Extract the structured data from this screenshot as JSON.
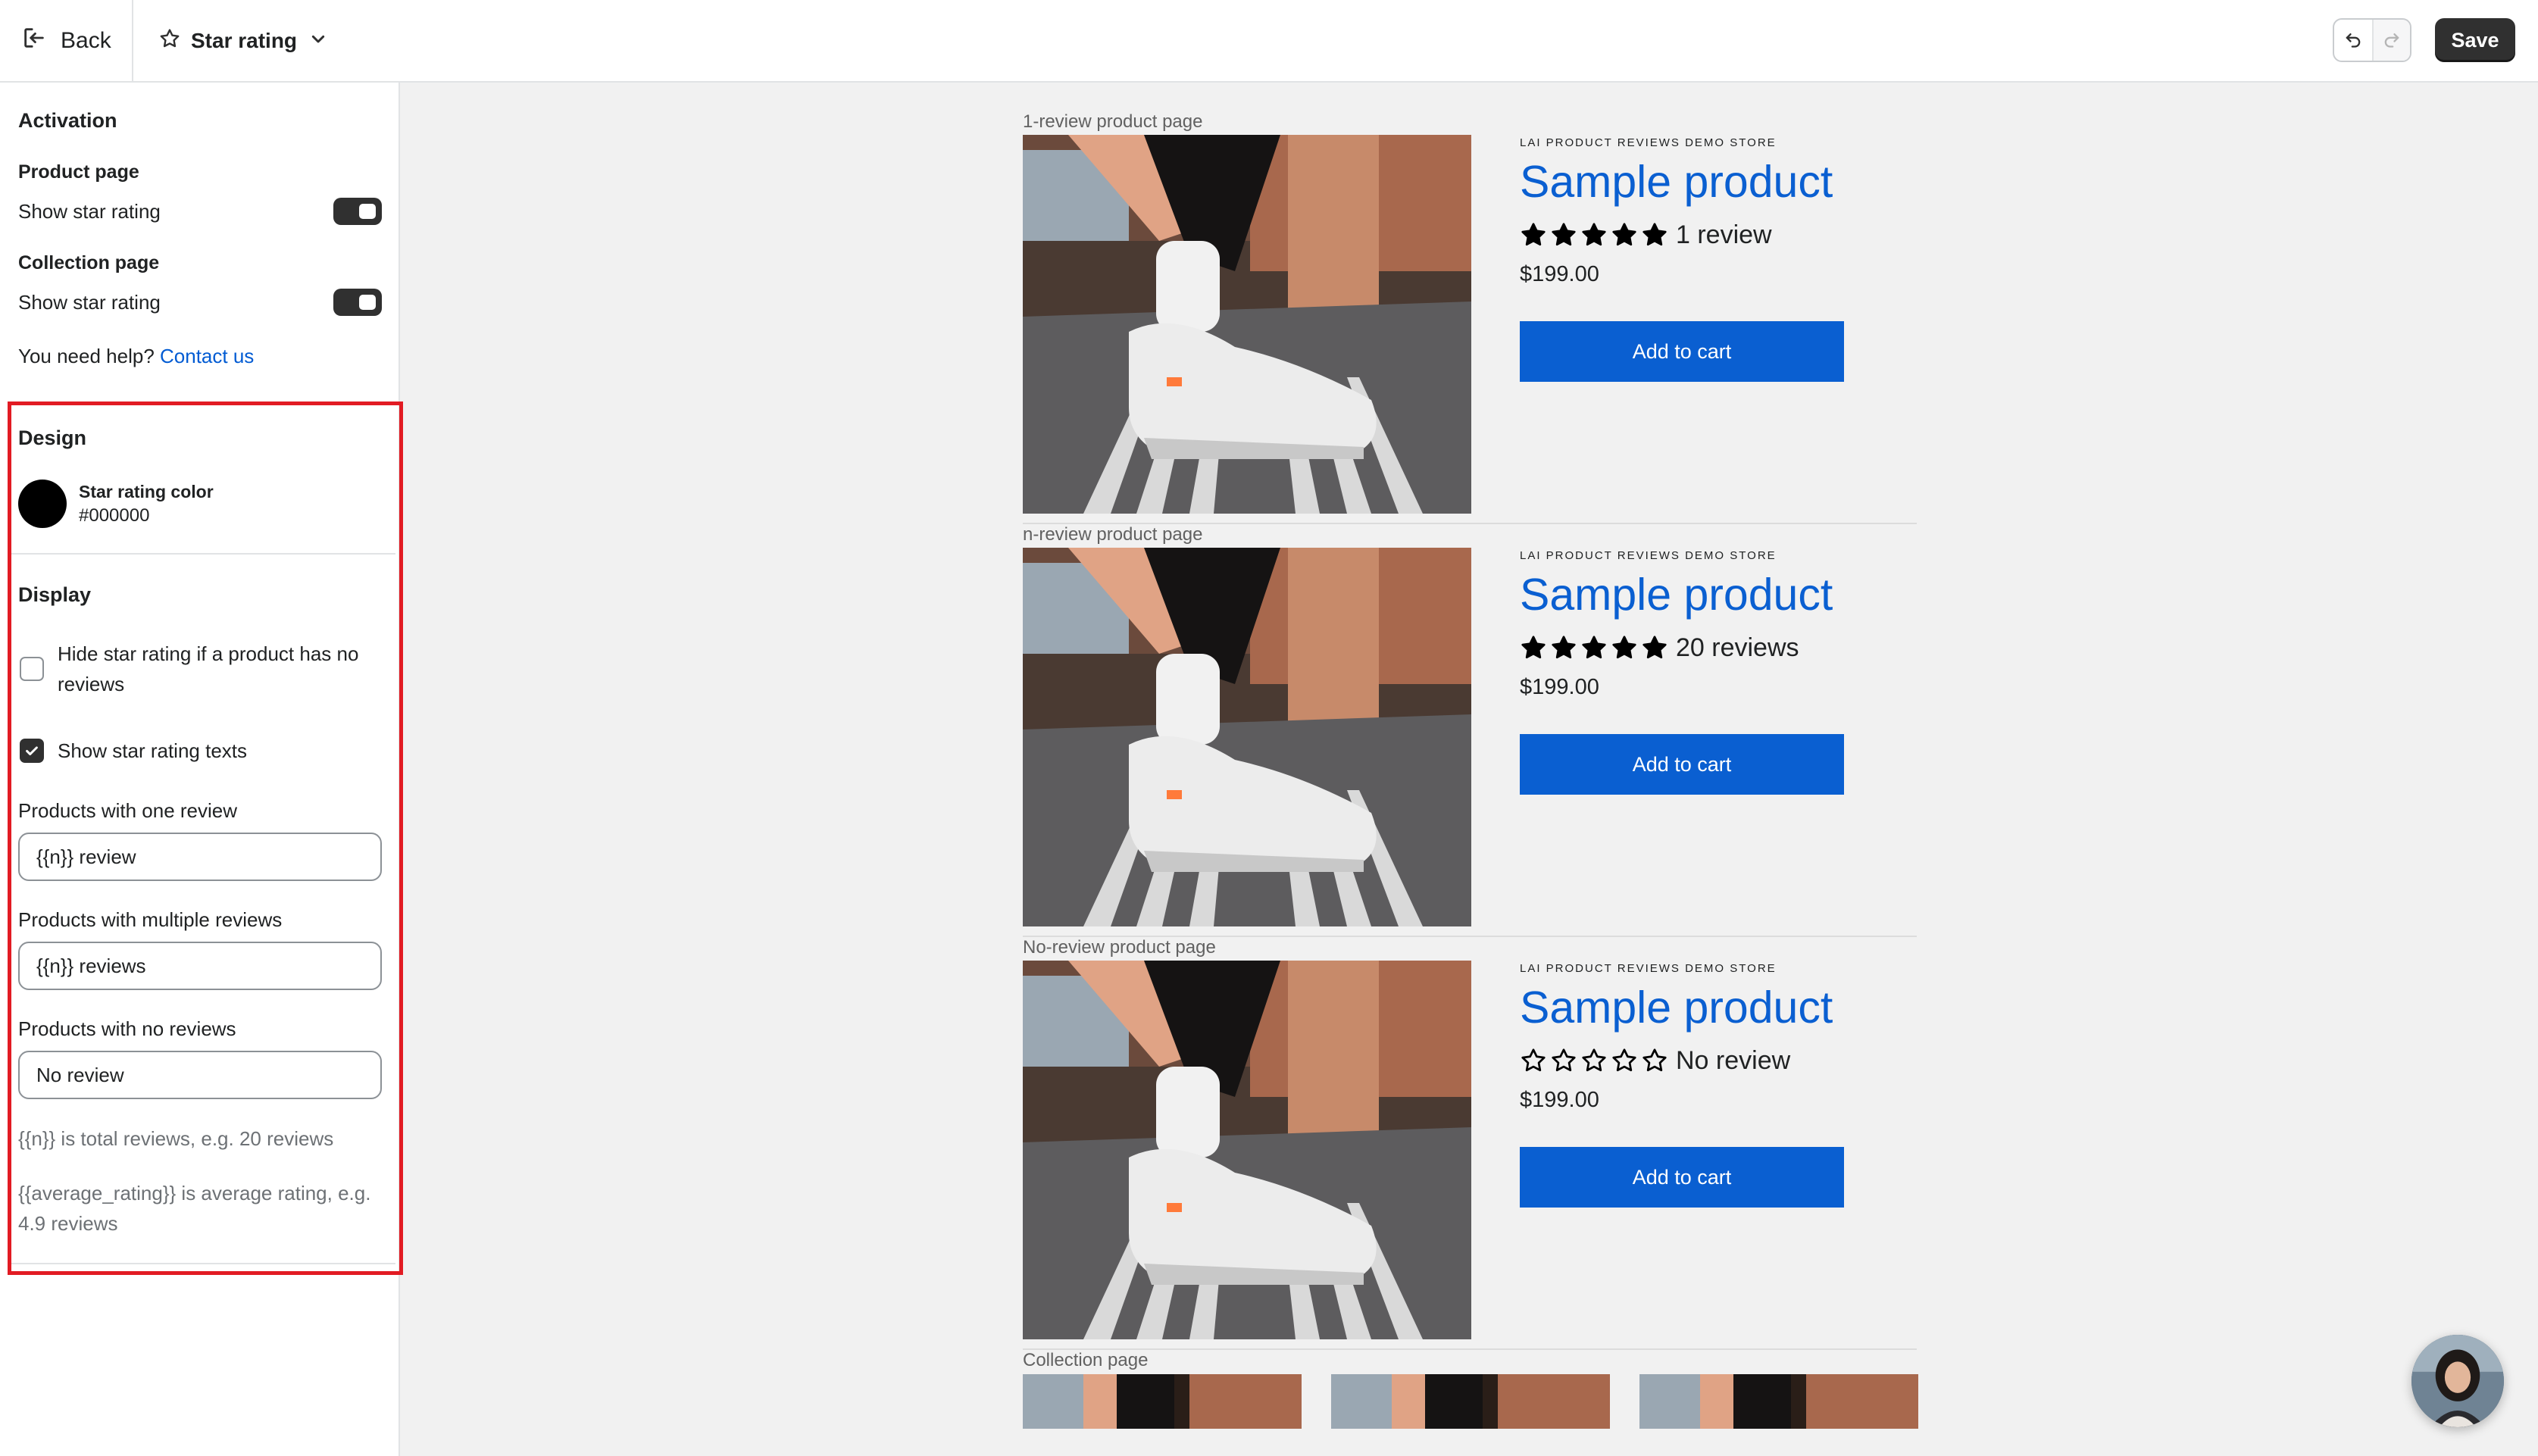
{
  "header": {
    "back_label": "Back",
    "page_picker_label": "Star rating",
    "save_label": "Save"
  },
  "activation": {
    "title": "Activation",
    "product_page": {
      "title": "Product page",
      "label": "Show star rating",
      "on": true
    },
    "collection_page": {
      "title": "Collection page",
      "label": "Show star rating",
      "on": true
    },
    "help_text": "You need help?",
    "help_link": "Contact us"
  },
  "design": {
    "title": "Design",
    "star_color_label": "Star rating color",
    "star_color_value": "#000000"
  },
  "display": {
    "title": "Display",
    "hide_if_none": {
      "label": "Hide star rating if a product has no reviews",
      "checked": false
    },
    "show_texts": {
      "label": "Show star rating texts",
      "checked": true
    },
    "one_review": {
      "label": "Products with one review",
      "value": "{{n}} review"
    },
    "multiple_reviews": {
      "label": "Products with multiple reviews",
      "value": "{{n}} reviews"
    },
    "no_reviews": {
      "label": "Products with no reviews",
      "value": "No review"
    },
    "hint_n": "{{n}} is total reviews, e.g. 20 reviews",
    "hint_avg": "{{average_rating}} is average rating, e.g. 4.9 reviews"
  },
  "preview": {
    "sections": [
      {
        "label": "1-review product page",
        "vendor": "LAI PRODUCT REVIEWS DEMO STORE",
        "title": "Sample product",
        "stars_filled": 5,
        "rating_text": "1 review",
        "price": "$199.00",
        "cart_label": "Add to cart"
      },
      {
        "label": "n-review product page",
        "vendor": "LAI PRODUCT REVIEWS DEMO STORE",
        "title": "Sample product",
        "stars_filled": 5,
        "rating_text": "20 reviews",
        "price": "$199.00",
        "cart_label": "Add to cart"
      },
      {
        "label": "No-review product page",
        "vendor": "LAI PRODUCT REVIEWS DEMO STORE",
        "title": "Sample product",
        "stars_filled": 0,
        "rating_text": "No review",
        "price": "$199.00",
        "cart_label": "Add to cart"
      }
    ],
    "collection_label": "Collection page"
  },
  "colors": {
    "accent_blue": "#0a5fd1",
    "star_color": "#000000",
    "highlight_red": "#e21b23"
  }
}
